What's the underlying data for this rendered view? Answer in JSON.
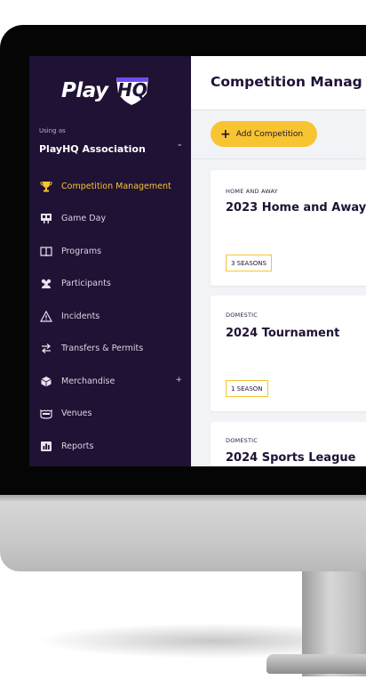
{
  "sidebar": {
    "logo_text": "Play",
    "logo_badge": "HQ",
    "using_label": "Using as",
    "organisation": "PlayHQ Association",
    "items": [
      {
        "label": "Competition Management",
        "icon": "trophy-icon",
        "active": true
      },
      {
        "label": "Game Day",
        "icon": "scoreboard-icon"
      },
      {
        "label": "Programs",
        "icon": "book-icon"
      },
      {
        "label": "Participants",
        "icon": "people-icon"
      },
      {
        "label": "Incidents",
        "icon": "warning-icon"
      },
      {
        "label": "Transfers & Permits",
        "icon": "transfer-arrows-icon"
      },
      {
        "label": "Merchandise",
        "icon": "box-icon",
        "expandable": true
      },
      {
        "label": "Venues",
        "icon": "stadium-icon"
      },
      {
        "label": "Reports",
        "icon": "bar-chart-icon"
      }
    ],
    "expand_symbol": "+"
  },
  "header": {
    "title": "Competition Manag"
  },
  "actions": {
    "add_label": "Add Competition",
    "add_symbol": "+"
  },
  "competitions": [
    {
      "type": "HOME AND AWAY",
      "name": "2023 Home and Away",
      "seasons": "3 SEASONS"
    },
    {
      "type": "DOMESTIC",
      "name": "2024 Tournament",
      "seasons": "1 SEASON"
    },
    {
      "type": "DOMESTIC",
      "name": "2024 Sports League",
      "seasons": ""
    }
  ],
  "colors": {
    "sidebar_bg": "#1f1235",
    "accent": "#f7c531",
    "content_bg": "#f2f3f6"
  }
}
